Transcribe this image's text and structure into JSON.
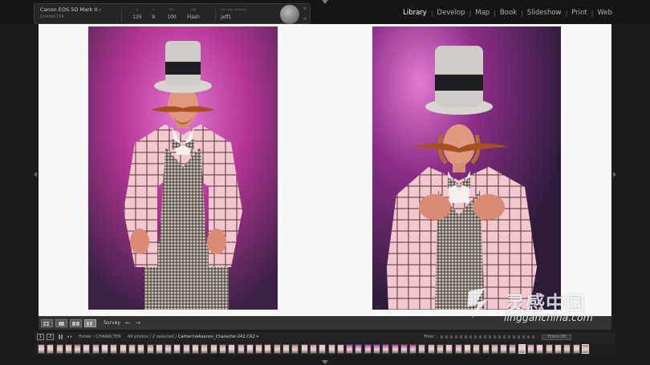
{
  "camera_hud": {
    "model": "Canon EOS 5D Mark II",
    "session": "CHARACTER",
    "shutter_label": "1/",
    "shutter_value": "125",
    "aperture_label": "f/",
    "aperture_value": "9",
    "iso_label": "ISO",
    "iso_value": "100",
    "wb_label": "WB",
    "wb_value": "Flash",
    "develop_label": "Develop Settings",
    "develop_value": "jeff1"
  },
  "modules": [
    "Library",
    "Develop",
    "Map",
    "Book",
    "Slideshow",
    "Print",
    "Web"
  ],
  "active_module": "Library",
  "toolbar": {
    "view_mode": "Survey"
  },
  "filmstrip_header": {
    "page1": "1",
    "page2": "2",
    "folder": "Folder : CHARACTER",
    "count": "48 photos / 2 selected /",
    "filename": "CatherineAsanov_Character-242.CR2",
    "filter_label": "Filter :",
    "filters_off": "Filters Off"
  },
  "colors": {
    "backdrop_magenta": "#c0309a",
    "jacket_pink": "#f2c4cc",
    "canvas": "#f8f8f8"
  },
  "watermark": {
    "chinese": "灵感中国",
    "url": "lingganchina.com"
  }
}
